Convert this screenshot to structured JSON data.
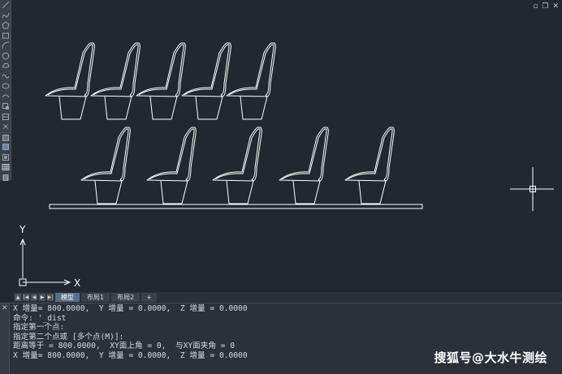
{
  "window_controls": [
    "▫",
    "❐",
    "✕"
  ],
  "toolbar": {
    "tools": [
      "line-icon",
      "polyline-icon",
      "polygon-icon",
      "rectangle-icon",
      "arc-icon",
      "circle-icon",
      "cloud-icon",
      "spline-icon",
      "ellipse-icon",
      "ellipse-arc-icon",
      "insert-block-icon",
      "make-block-icon",
      "point-icon",
      "hatch-icon",
      "gradient-icon",
      "region-icon",
      "table-icon",
      "mtext-icon"
    ]
  },
  "drawing": {
    "axis_x_label": "X",
    "axis_y_label": "Y",
    "line_color": "#ffffff"
  },
  "tabs": {
    "nav": [
      "▲",
      "|◀",
      "◀",
      "▶",
      "▶|"
    ],
    "items": [
      "模型",
      "布局1",
      "布局2",
      "+"
    ],
    "active": "模型"
  },
  "command_history": [
    "X 增量= 800.0000,  Y 增量 = 0.0000,  Z 增量 = 0.0000",
    "命令: '_dist",
    "指定第一个点:",
    "指定第二个点或 [多个点(M)]:",
    "距离等于 = 800.0000,  XY面上角 = 0,  与XY面夹角 = 0",
    "X 增量= 800.0000,  Y 增量 = 0.0000,  Z 增量 = 0.0000"
  ],
  "watermark": "搜狐号@大水牛测绘"
}
